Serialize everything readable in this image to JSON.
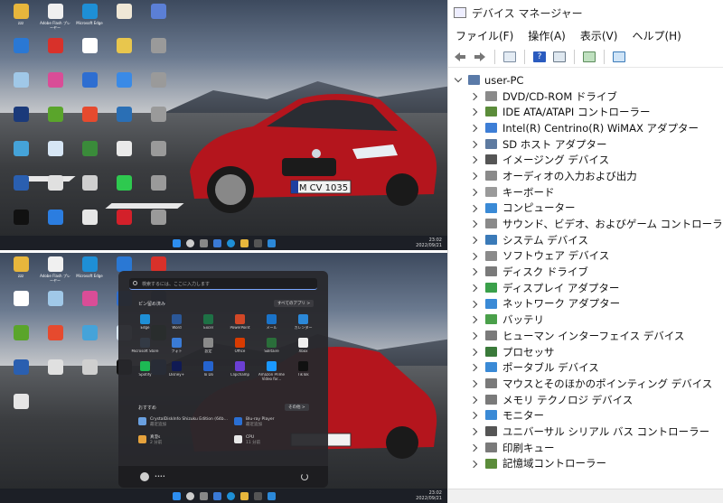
{
  "desktop": {
    "plate_text": "M CV 1035",
    "tray_time": "23:02",
    "tray_date": "2022/09/21",
    "icons": [
      {
        "label": "zzz",
        "color": "#e7b63c"
      },
      {
        "label": "Adobe Flash プレーヤー",
        "color": "#f0f0f0"
      },
      {
        "label": "Microsoft Edge",
        "color": "#1e8fd6"
      },
      {
        "label": "",
        "color": "#efe7d6"
      },
      {
        "label": "",
        "color": "#5b7fd6"
      },
      {
        "label": "",
        "color": "#2a78d4"
      },
      {
        "label": "",
        "color": "#d8312a"
      },
      {
        "label": "",
        "color": "#ffffff"
      },
      {
        "label": "",
        "color": "#e8c64d"
      },
      {
        "label": "",
        "color": "#9a9a9a"
      },
      {
        "label": "",
        "color": "#a0c8e8"
      },
      {
        "label": "",
        "color": "#d94d97"
      },
      {
        "label": "",
        "color": "#2e6ed1"
      },
      {
        "label": "",
        "color": "#3a8ae6"
      },
      {
        "label": "",
        "color": "#9a9a9a"
      },
      {
        "label": "",
        "color": "#1b3a7a"
      },
      {
        "label": "",
        "color": "#5aa52b"
      },
      {
        "label": "",
        "color": "#e64a2e"
      },
      {
        "label": "",
        "color": "#2a6fb5"
      },
      {
        "label": "",
        "color": "#9a9a9a"
      },
      {
        "label": "",
        "color": "#45a3d9"
      },
      {
        "label": "",
        "color": "#d7e6f5"
      },
      {
        "label": "",
        "color": "#3a8b3a"
      },
      {
        "label": "",
        "color": "#eaeaea"
      },
      {
        "label": "",
        "color": "#9a9a9a"
      },
      {
        "label": "",
        "color": "#2a5fb0"
      },
      {
        "label": "",
        "color": "#e0e0e0"
      },
      {
        "label": "",
        "color": "#cfcfcf"
      },
      {
        "label": "",
        "color": "#2ec94f"
      },
      {
        "label": "",
        "color": "#9a9a9a"
      },
      {
        "label": "",
        "color": "#111111"
      },
      {
        "label": "",
        "color": "#2b7de0"
      },
      {
        "label": "",
        "color": "#e6e6e6"
      },
      {
        "label": "",
        "color": "#d3202a"
      },
      {
        "label": "",
        "color": "#9a9a9a"
      }
    ]
  },
  "start_menu": {
    "search_placeholder": "検索するには、ここに入力します",
    "pinned_heading": "ピン留め済み",
    "all_apps": "すべてのアプリ >",
    "recommended_heading": "おすすめ",
    "more": "その他 >",
    "pinned": [
      {
        "label": "Edge",
        "color": "#1e8fd6"
      },
      {
        "label": "Word",
        "color": "#2b5797"
      },
      {
        "label": "Excel",
        "color": "#1e7145"
      },
      {
        "label": "PowerPoint",
        "color": "#d24726"
      },
      {
        "label": "メール",
        "color": "#1a73c9"
      },
      {
        "label": "カレンダー",
        "color": "#2b88d8"
      },
      {
        "label": "Microsoft Store",
        "color": "#333a45"
      },
      {
        "label": "フォト",
        "color": "#3a7bd5"
      },
      {
        "label": "設定",
        "color": "#8a8a8a"
      },
      {
        "label": "Office",
        "color": "#d83b01"
      },
      {
        "label": "Solitaire",
        "color": "#2a6e3a"
      },
      {
        "label": "Xbox",
        "color": "#eeeeee"
      },
      {
        "label": "Spotify",
        "color": "#1db954"
      },
      {
        "label": "Disney+",
        "color": "#101a54"
      },
      {
        "label": "To Do",
        "color": "#2564cf"
      },
      {
        "label": "Clipchamp",
        "color": "#6b3fd4"
      },
      {
        "label": "Amazon Prime Video for...",
        "color": "#1a98ff"
      },
      {
        "label": "TikTok",
        "color": "#111111"
      }
    ],
    "recommended": [
      {
        "title": "CrystalDiskInfo Shizuku Edition (64b...",
        "sub": "最近追加",
        "color": "#6aa0e0"
      },
      {
        "title": "Blu-ray Player",
        "sub": "最近追加",
        "color": "#2a6fd4"
      },
      {
        "title": "真澄s",
        "sub": "2 分前",
        "color": "#e6a23c"
      },
      {
        "title": "CPU",
        "sub": "11 分前",
        "color": "#e8e8e8"
      }
    ],
    "user_name": "••••"
  },
  "device_manager": {
    "title": "デバイス マネージャー",
    "menu": [
      "ファイル(F)",
      "操作(A)",
      "表示(V)",
      "ヘルプ(H)"
    ],
    "root": "user-PC",
    "categories": [
      {
        "label": "DVD/CD-ROM ドライブ",
        "icon": "disc-drive-icon",
        "color": "#8a8a8a"
      },
      {
        "label": "IDE ATA/ATAPI コントローラー",
        "icon": "controller-icon",
        "color": "#5b8c3a"
      },
      {
        "label": "Intel(R) Centrino(R) WiMAX アダプター",
        "icon": "wimax-icon",
        "color": "#3d7ed6"
      },
      {
        "label": "SD ホスト アダプター",
        "icon": "sd-host-icon",
        "color": "#5d7aa0"
      },
      {
        "label": "イメージング デバイス",
        "icon": "camera-icon",
        "color": "#555555"
      },
      {
        "label": "オーディオの入力および出力",
        "icon": "speaker-icon",
        "color": "#8a8a8a"
      },
      {
        "label": "キーボード",
        "icon": "keyboard-icon",
        "color": "#9a9a9a"
      },
      {
        "label": "コンピューター",
        "icon": "computer-icon",
        "color": "#3a8ad6"
      },
      {
        "label": "サウンド、ビデオ、およびゲーム コントローラー",
        "icon": "sound-icon",
        "color": "#8a8a8a"
      },
      {
        "label": "システム デバイス",
        "icon": "system-device-icon",
        "color": "#3a7ab8"
      },
      {
        "label": "ソフトウェア デバイス",
        "icon": "software-device-icon",
        "color": "#8a8a8a"
      },
      {
        "label": "ディスク ドライブ",
        "icon": "disk-drive-icon",
        "color": "#7a7a7a"
      },
      {
        "label": "ディスプレイ アダプター",
        "icon": "display-adapter-icon",
        "color": "#3aa04a"
      },
      {
        "label": "ネットワーク アダプター",
        "icon": "network-adapter-icon",
        "color": "#3a8ad6"
      },
      {
        "label": "バッテリ",
        "icon": "battery-icon",
        "color": "#4aa04a"
      },
      {
        "label": "ヒューマン インターフェイス デバイス",
        "icon": "hid-icon",
        "color": "#7a7a7a"
      },
      {
        "label": "プロセッサ",
        "icon": "processor-icon",
        "color": "#3a7a3a"
      },
      {
        "label": "ポータブル デバイス",
        "icon": "portable-device-icon",
        "color": "#3a8ad6"
      },
      {
        "label": "マウスとそのほかのポインティング デバイス",
        "icon": "mouse-icon",
        "color": "#7a7a7a"
      },
      {
        "label": "メモリ テクノロジ デバイス",
        "icon": "memory-icon",
        "color": "#7a7a7a"
      },
      {
        "label": "モニター",
        "icon": "monitor-icon",
        "color": "#3a8ad6"
      },
      {
        "label": "ユニバーサル シリアル バス コントローラー",
        "icon": "usb-icon",
        "color": "#555555"
      },
      {
        "label": "印刷キュー",
        "icon": "printer-icon",
        "color": "#7a7a7a"
      },
      {
        "label": "記憶域コントローラー",
        "icon": "storage-controller-icon",
        "color": "#5b8c3a"
      }
    ]
  }
}
